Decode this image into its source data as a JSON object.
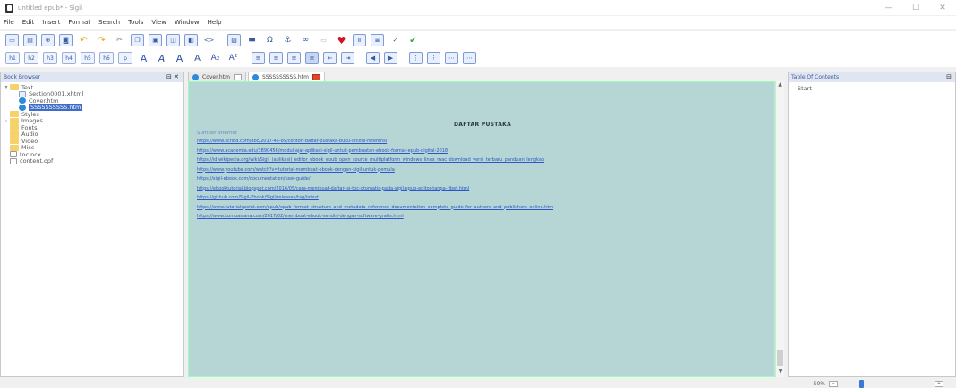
{
  "window": {
    "title": "untitled epub* - Sigil",
    "controls": [
      "—",
      "☐",
      "✕"
    ]
  },
  "menu": [
    "File",
    "Edit",
    "Insert",
    "Format",
    "Search",
    "Tools",
    "View",
    "Window",
    "Help"
  ],
  "toolbar_headings": [
    "h1",
    "h2",
    "h3",
    "h4",
    "h5",
    "h6",
    "p"
  ],
  "book_browser": {
    "title": "Book Browser",
    "buttons": "⊟ ✕",
    "items": [
      {
        "label": "Text",
        "level": 0,
        "type": "folder",
        "twisty": "▾"
      },
      {
        "label": "Section0001.xhtml",
        "level": 1,
        "type": "xhtml"
      },
      {
        "label": "Cover.htm",
        "level": 1,
        "type": "web"
      },
      {
        "label": "SSSSSSSSSS.htm",
        "level": 1,
        "type": "web",
        "selected": true
      },
      {
        "label": "Styles",
        "level": 0,
        "type": "folder"
      },
      {
        "label": "Images",
        "level": 0,
        "type": "folder",
        "twisty": "›"
      },
      {
        "label": "Fonts",
        "level": 0,
        "type": "folder"
      },
      {
        "label": "Audio",
        "level": 0,
        "type": "folder"
      },
      {
        "label": "Video",
        "level": 0,
        "type": "folder"
      },
      {
        "label": "Misc",
        "level": 0,
        "type": "folder"
      },
      {
        "label": "toc.ncx",
        "level": 0,
        "type": "doc"
      },
      {
        "label": "content.opf",
        "level": 0,
        "type": "doc"
      }
    ]
  },
  "tabs": [
    {
      "label": "Cover.htm",
      "active": false
    },
    {
      "label": "SSSSSSSSSS.htm",
      "active": true
    }
  ],
  "document": {
    "heading": "DAFTAR PUSTAKA",
    "subheading": "Sumber Internet",
    "links": [
      "https://www.scribd.com/doc/2017-45-89/contoh-daftar-pustaka-buku-online-referensi",
      "https://www.academia.edu/3890456/modul-ajar-aplikasi-sigil-untuk-pembuatan-ebook-format-epub-digital-2018",
      "https://id.wikipedia.org/wiki/Sigil_(aplikasi)_editor_ebook_epub_open_source_multiplatform_windows_linux_mac_download_versi_terbaru_panduan_lengkap",
      "https://www.youtube.com/watch?v=tutorial-membuat-ebook-dengan-sigil-untuk-pemula",
      "https://sigil-ebook.com/documentation/user-guide/",
      "https://ebooktutorial.blogspot.com/2016/05/cara-membuat-daftar-isi-toc-otomatis-pada-sigil-epub-editor-tanpa-ribet.html",
      "https://github.com/Sigil-Ebook/Sigil/releases/tag/latest",
      "https://www.tutorialspoint.com/epub/epub_format_structure_and_metadata_reference_documentation_complete_guide_for_authors_and_publishers_online.htm",
      "https://www.kompasiana.com/2017/02/membuat-ebook-sendiri-dengan-software-gratis.html"
    ]
  },
  "toc": {
    "title": "Table Of Contents",
    "buttons": "⊟",
    "items": [
      "Start"
    ]
  },
  "status": {
    "zoom_label": "50%",
    "zoom_level": 0.2
  }
}
